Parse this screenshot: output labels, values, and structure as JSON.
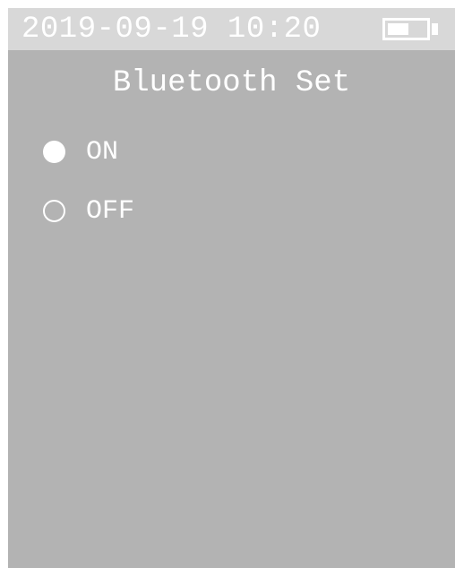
{
  "status_bar": {
    "datetime": "2019-09-19 10:20",
    "battery_icon": "battery-icon",
    "battery_level": 0.55
  },
  "screen": {
    "title": "Bluetooth Set"
  },
  "options": [
    {
      "label": "ON",
      "selected": true
    },
    {
      "label": "OFF",
      "selected": false
    }
  ],
  "colors": {
    "screen_background": "#b3b3b3",
    "status_bar_background": "#d8d8d8",
    "foreground": "#ffffff"
  }
}
